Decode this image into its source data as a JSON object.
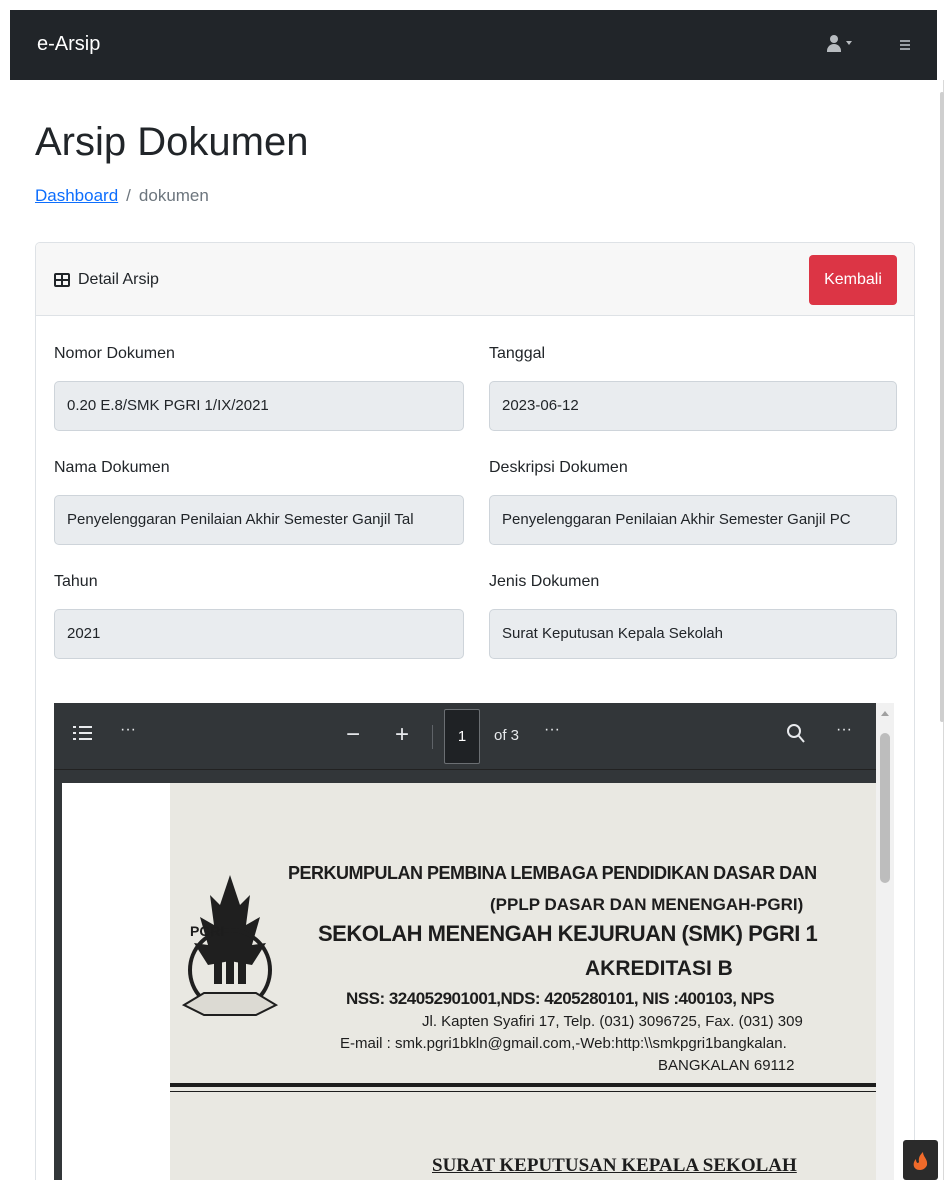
{
  "navbar": {
    "brand": "e-Arsip",
    "user_icon": "user-icon",
    "menu_icon": "hamburger-icon"
  },
  "page": {
    "title": "Arsip Dokumen",
    "breadcrumb": {
      "link": "Dashboard",
      "separator": "/",
      "current": "dokumen"
    }
  },
  "card": {
    "header_icon": "table-icon",
    "header_title": "Detail Arsip",
    "back_button": "Kembali",
    "fields": {
      "nomor_label": "Nomor Dokumen",
      "nomor_value": "0.20 E.8/SMK PGRI 1/IX/2021",
      "tanggal_label": "Tanggal",
      "tanggal_value": "2023-06-12",
      "nama_label": "Nama Dokumen",
      "nama_value": "Penyelenggaran Penilaian Akhir Semester Ganjil Tal",
      "deskripsi_label": "Deskripsi Dokumen",
      "deskripsi_value": "Penyelenggaran Penilaian Akhir Semester Ganjil PC",
      "tahun_label": "Tahun",
      "tahun_value": "2021",
      "jenis_label": "Jenis Dokumen",
      "jenis_value": "Surat Keputusan Kepala Sekolah"
    }
  },
  "pdf_viewer": {
    "page_number": "1",
    "page_total": "of 3",
    "controls": {
      "minus": "−",
      "plus": "+",
      "more": "···",
      "outline_icon": "list-icon",
      "search_icon": "search-icon"
    },
    "document": {
      "line1": "PERKUMPULAN PEMBINA LEMBAGA PENDIDIKAN DASAR DAN",
      "line2": "(PPLP DASAR DAN MENENGAH-PGRI)",
      "line3": "SEKOLAH MENENGAH KEJURUAN (SMK) PGRI 1",
      "line4": "AKREDITASI B",
      "line5": "NSS: 324052901001,NDS: 4205280101, NIS :400103, NPS",
      "line6": "Jl. Kapten Syafiri 17, Telp. (031) 3096725, Fax. (031) 309",
      "line7": "E-mail : smk.pgri1bkln@gmail.com,-Web:http:\\\\smkpgri1bangkalan.",
      "line8": "BANGKALAN 69112",
      "heading": "SURAT KEPUTUSAN KEPALA SEKOLAH",
      "logo_text": "PGRI"
    }
  },
  "colors": {
    "navbar": "#212529",
    "danger": "#dc3545",
    "link": "#0d6efd",
    "field_bg": "#e9ecef",
    "pdf_toolbar": "#323639"
  }
}
